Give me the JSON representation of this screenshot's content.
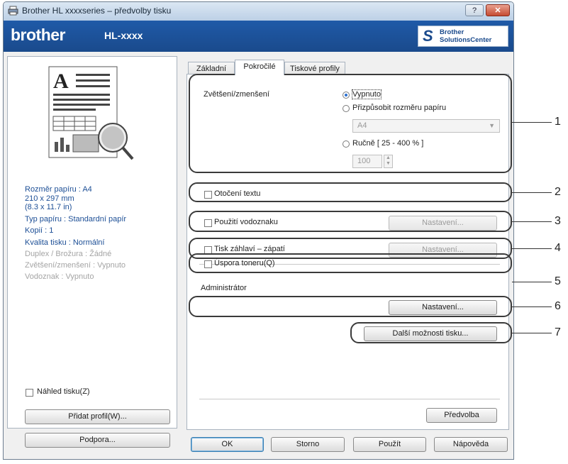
{
  "window": {
    "title": "Brother HL xxxxseries – předvolby tisku",
    "help_label": "?",
    "close_label": "✕"
  },
  "banner": {
    "brand": "brother",
    "model": "HL-xxxx",
    "solutions_logo": "S",
    "solutions_line1": "Brother",
    "solutions_line2": "SolutionsCenter"
  },
  "summary": {
    "lines": [
      "Rozměr papíru : A4",
      "210 x 297 mm",
      "(8.3 x 11.7 in)",
      "Typ papíru : Standardní papír",
      "Kopií : 1",
      "Kvalita tisku : Normální",
      "Duplex / Brožura : Žádné",
      "Zvětšení/zmenšení : Vypnuto",
      "Vodoznak : Vypnuto"
    ]
  },
  "left": {
    "preview_label": "Náhled tisku(Z)",
    "add_profile": "Přidat profil(W)...",
    "support": "Podpora..."
  },
  "tabs": [
    "Základní",
    "Pokročilé",
    "Tiskové profily"
  ],
  "advanced": {
    "scaling_label": "Zvětšení/zmenšení",
    "opt_off": "Vypnuto",
    "opt_fit": "Přizpůsobit rozměru papíru",
    "paper_size": "A4",
    "opt_manual": "Ručně [ 25 - 400 % ]",
    "manual_value": "100",
    "reverse_print": "Otočení textu",
    "watermark": "Použití vodoznaku",
    "header_footer": "Tisk záhlaví – zápatí",
    "toner_save": "Úspora toneru(Q)",
    "administrator": "Administrátor",
    "settings": "Nastavení...",
    "other_options": "Další možnosti tisku...",
    "default": "Předvolba"
  },
  "footer": {
    "ok": "OK",
    "cancel": "Storno",
    "apply": "Použít",
    "help": "Nápověda"
  },
  "callouts": [
    "1",
    "2",
    "3",
    "4",
    "5",
    "6",
    "7"
  ]
}
